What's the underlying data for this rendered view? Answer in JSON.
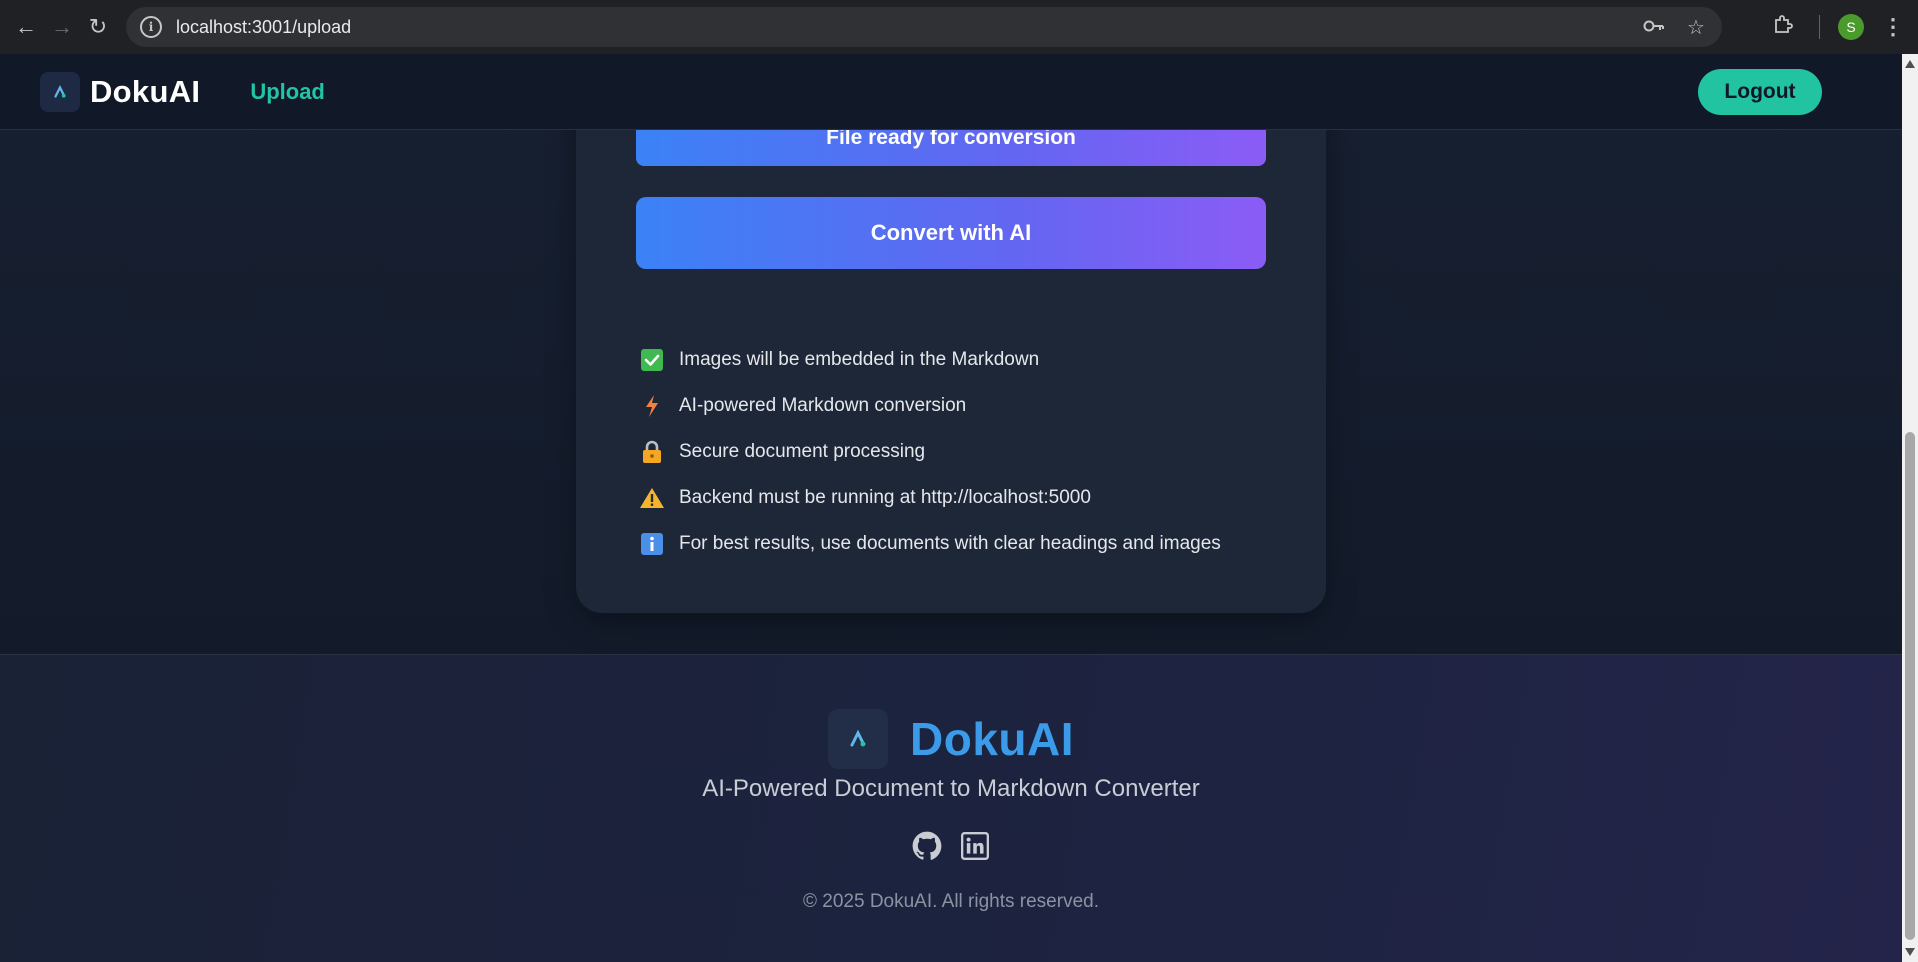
{
  "browser": {
    "url": "localhost:3001/upload",
    "profile_initial": "S",
    "icons": {
      "back": "arrow-left-icon",
      "forward": "arrow-right-icon",
      "reload": "reload-icon",
      "site_info": "info-icon",
      "password": "key-icon",
      "bookmark": "star-icon",
      "extensions": "puzzle-icon",
      "menu": "kebab-menu-icon"
    }
  },
  "navbar": {
    "brand": "DokuAI",
    "upload_link": "Upload",
    "logout_label": "Logout"
  },
  "card": {
    "ready_label": "File ready for conversion",
    "convert_label": "Convert with AI",
    "features": [
      {
        "icon": "check-box-icon",
        "text": "Images will be embedded in the Markdown"
      },
      {
        "icon": "lightning-icon",
        "text": "AI-powered Markdown conversion"
      },
      {
        "icon": "lock-icon",
        "text": "Secure document processing"
      },
      {
        "icon": "warning-icon",
        "text": "Backend must be running at http://localhost:5000"
      },
      {
        "icon": "info-icon",
        "text": "For best results, use documents with clear headings and images"
      }
    ]
  },
  "footer": {
    "brand": "DokuAI",
    "tagline": "AI-Powered Document to Markdown Converter",
    "socials": [
      "github-icon",
      "linkedin-icon"
    ],
    "copyright": "© 2025 DokuAI. All rights reserved."
  },
  "colors": {
    "accent": "#22c3a0",
    "brand_blue": "#3b9be8",
    "gradient_start": "#3b82f6",
    "gradient_end": "#8b5cf6",
    "page_bg": "#141b2b",
    "card_bg": "#1d2738"
  }
}
